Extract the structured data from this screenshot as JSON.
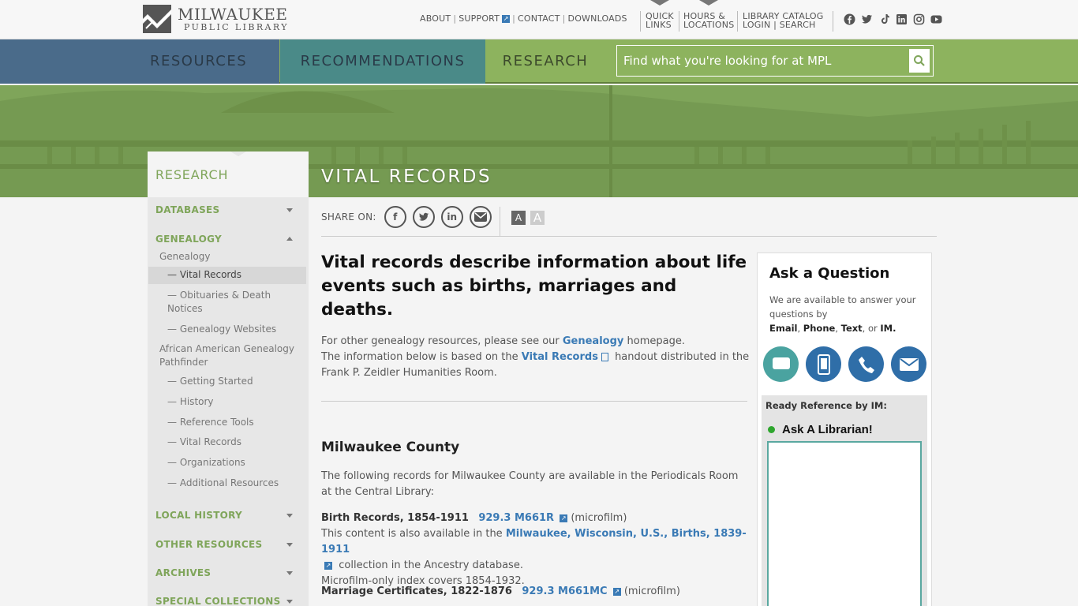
{
  "logo": {
    "line1": "MILWAUKEE",
    "line2": "PUBLIC LIBRARY"
  },
  "toplinks": {
    "about": "ABOUT",
    "support": "SUPPORT",
    "contact": "CONTACT",
    "downloads": "DOWNLOADS"
  },
  "quick_links": {
    "l1": "QUICK",
    "l2": "LINKS"
  },
  "hours": {
    "l1": "HOURS &",
    "l2": "LOCATIONS"
  },
  "catalog": {
    "l1": "LIBRARY CATALOG",
    "login": "LOGIN",
    "search": "SEARCH"
  },
  "social_icons": [
    "facebook-icon",
    "twitter-icon",
    "tiktok-icon",
    "linkedin-icon",
    "instagram-icon",
    "youtube-icon"
  ],
  "nav": {
    "resources": "RESOURCES",
    "recommendations": "RECOMMENDATIONS",
    "research": "RESEARCH"
  },
  "search": {
    "placeholder": "Find what you're looking for at MPL"
  },
  "hero": {
    "title": "VITAL RECORDS"
  },
  "colors": {
    "green": "#8db35e",
    "blue": "#4a6b8a",
    "teal": "#4a8a88",
    "link": "#3a7ab5"
  },
  "sidebar": {
    "heading": "RESEARCH",
    "databases": "DATABASES",
    "genealogy": "GENEALOGY",
    "links": {
      "genealogy": "Genealogy",
      "vital_records": "Vital Records",
      "obituaries": "Obituaries & Death",
      "obituaries2": "Notices",
      "genealogy_websites": "Genealogy Websites",
      "african_american": "African American Genealogy",
      "pathfinder": "Pathfinder",
      "getting_started": "Getting Started",
      "history": "History",
      "reference_tools": "Reference Tools",
      "vital_records2": "Vital Records",
      "organizations": "Organizations",
      "additional": "Additional Resources"
    },
    "local_history": "LOCAL HISTORY",
    "other_resources": "OTHER RESOURCES",
    "archives": "ARCHIVES",
    "special_collections": "SPECIAL COLLECTIONS"
  },
  "share": {
    "label": "SHARE ON:",
    "fontsize_small": "A",
    "fontsize_large": "A"
  },
  "content": {
    "lead": "Vital records describe information about life events such as births, marriages and deaths.",
    "p1_a": "For other genealogy resources, please see our ",
    "p1_link": "Genealogy",
    "p1_b": " homepage.",
    "p2_a": "The information below is based on the ",
    "p2_link": "Vital Records",
    "p2_b": " handout distributed in the Frank P. Zeidler Humanities Room.",
    "h_county": "Milwaukee County",
    "p_county": "The following records for Milwaukee County are available in the Periodicals Room at the Central Library:",
    "birth_title": "Birth Records, 1854-1911",
    "birth_call": "929.3 M661R",
    "birth_format": "(microfilm)",
    "birth_also": "This content is also available in the ",
    "birth_link": "Milwaukee, Wisconsin, U.S., Births, 1839-1911",
    "birth_coll": " collection in the Ancestry database.",
    "birth_index": "Microfilm-only index covers 1854-1932.",
    "marriage_title": "Marriage Certificates, 1822-1876",
    "marriage_call": "929.3 M661MC",
    "marriage_format": "(microfilm)"
  },
  "ask": {
    "title": "Ask a Question",
    "text_a": "We are available to answer your questions by",
    "email": "Email",
    "phone": "Phone",
    "text": "Text",
    "or": ", or ",
    "im": "IM.",
    "ready_label": "Ready Reference by IM:",
    "live_label": "Ask A Librarian!"
  }
}
